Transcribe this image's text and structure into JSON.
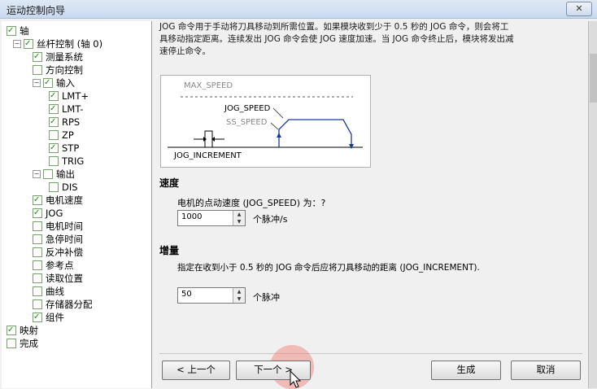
{
  "window": {
    "title": "运动控制向导",
    "close_glyph": "✕"
  },
  "tree": [
    {
      "id": "axis",
      "label": "轴",
      "checked": true,
      "level": 0,
      "expander": ""
    },
    {
      "id": "screw",
      "label": "丝杆控制 (轴 0)",
      "checked": true,
      "level": 1,
      "expander": "−"
    },
    {
      "id": "measure",
      "label": "测量系统",
      "checked": true,
      "level": 2,
      "expander": ""
    },
    {
      "id": "direction",
      "label": "方向控制",
      "checked": false,
      "level": 2,
      "expander": ""
    },
    {
      "id": "input",
      "label": "输入",
      "checked": true,
      "level": 2,
      "expander": "−"
    },
    {
      "id": "lmtp",
      "label": "LMT+",
      "checked": true,
      "level": 3,
      "expander": ""
    },
    {
      "id": "lmtm",
      "label": "LMT-",
      "checked": true,
      "level": 3,
      "expander": ""
    },
    {
      "id": "rps",
      "label": "RPS",
      "checked": true,
      "level": 3,
      "expander": ""
    },
    {
      "id": "zp",
      "label": "ZP",
      "checked": false,
      "level": 3,
      "expander": ""
    },
    {
      "id": "stp",
      "label": "STP",
      "checked": true,
      "level": 3,
      "expander": ""
    },
    {
      "id": "trig",
      "label": "TRIG",
      "checked": false,
      "level": 3,
      "expander": ""
    },
    {
      "id": "output",
      "label": "输出",
      "checked": false,
      "level": 2,
      "expander": "−"
    },
    {
      "id": "dis",
      "label": "DIS",
      "checked": false,
      "level": 3,
      "expander": ""
    },
    {
      "id": "motorspeed",
      "label": "电机速度",
      "checked": true,
      "level": 2,
      "expander": ""
    },
    {
      "id": "jog",
      "label": "JOG",
      "checked": true,
      "level": 2,
      "expander": ""
    },
    {
      "id": "motortime",
      "label": "电机时间",
      "checked": false,
      "level": 2,
      "expander": ""
    },
    {
      "id": "estop",
      "label": "急停时间",
      "checked": false,
      "level": 2,
      "expander": ""
    },
    {
      "id": "backlash",
      "label": "反冲补偿",
      "checked": false,
      "level": 2,
      "expander": ""
    },
    {
      "id": "refpoint",
      "label": "参考点",
      "checked": false,
      "level": 2,
      "expander": ""
    },
    {
      "id": "readpos",
      "label": "读取位置",
      "checked": false,
      "level": 2,
      "expander": ""
    },
    {
      "id": "curve",
      "label": "曲线",
      "checked": false,
      "level": 2,
      "expander": ""
    },
    {
      "id": "memalloc",
      "label": "存储器分配",
      "checked": false,
      "level": 2,
      "expander": ""
    },
    {
      "id": "component",
      "label": "组件",
      "checked": true,
      "level": 2,
      "expander": ""
    },
    {
      "id": "mapping",
      "label": "映射",
      "checked": true,
      "level": 0,
      "expander": ""
    },
    {
      "id": "finish",
      "label": "完成",
      "checked": false,
      "level": 0,
      "expander": ""
    }
  ],
  "description": {
    "line1": "JOG 命令用于手动将刀具移动到所需位置。如果模块收到少于 0.5 秒的 JOG 命令，则会将工",
    "line2": "具移动指定距离。连续发出 JOG 命令会使 JOG 速度加速。当 JOG 命令终止后，模块将发出减",
    "line3": "速停止命令。"
  },
  "diagram": {
    "max_speed": "MAX_SPEED",
    "jog_speed": "JOG_SPEED",
    "ss_speed": "SS_SPEED",
    "jog_increment": "JOG_INCREMENT"
  },
  "speed": {
    "heading": "速度",
    "prompt": "电机的点动速度 (JOG_SPEED) 为：?",
    "value": "1000",
    "unit": "个脉冲/s"
  },
  "increment": {
    "heading": "增量",
    "prompt": "指定在收到小于 0.5 秒的 JOG 命令后应将刀具移动的距离 (JOG_INCREMENT).",
    "value": "50",
    "unit": "个脉冲"
  },
  "buttons": {
    "prev": "< 上一个",
    "next": "下一个 >",
    "generate": "生成",
    "cancel": "取消"
  },
  "colors": {
    "check": "#1d8a1d",
    "diagram_line": "#1a3a9a",
    "dashed": "#555555"
  }
}
